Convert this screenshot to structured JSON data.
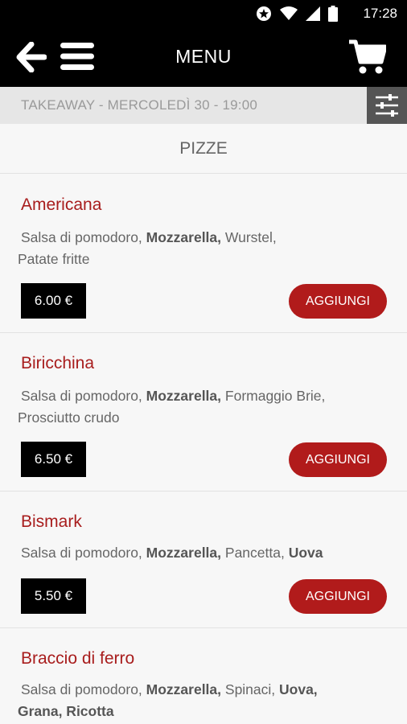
{
  "status_bar": {
    "time": "17:28",
    "icons": [
      "notification-star-icon",
      "wifi-icon",
      "cell-signal-icon",
      "battery-icon"
    ]
  },
  "app_bar": {
    "title": "MENU",
    "back_icon": "back-arrow-icon",
    "menu_icon": "hamburger-menu-icon",
    "cart_icon": "cart-icon"
  },
  "info_bar": {
    "text": "TAKEAWAY - MERCOLEDÌ 30 - 19:00",
    "filter_icon": "filter-sliders-icon"
  },
  "section": {
    "title": "PIZZE"
  },
  "items": [
    {
      "name": "Americana",
      "desc_parts": [
        {
          "text": "Salsa di pomodoro, ",
          "bold": false
        },
        {
          "text": "Mozzarella,",
          "bold": true
        },
        {
          "text": " Wurstel,",
          "bold": false
        },
        {
          "text": " Patate fritte",
          "bold": false
        }
      ],
      "price": "6.00 €",
      "add_label": "AGGIUNGI"
    },
    {
      "name": "Biricchina",
      "desc_parts": [
        {
          "text": "Salsa di pomodoro, ",
          "bold": false
        },
        {
          "text": "Mozzarella,",
          "bold": true
        },
        {
          "text": " Formaggio Brie,",
          "bold": false
        },
        {
          "text": " Prosciutto crudo",
          "bold": false
        }
      ],
      "price": "6.50 €",
      "add_label": "AGGIUNGI"
    },
    {
      "name": "Bismark",
      "desc_parts": [
        {
          "text": "Salsa di pomodoro, ",
          "bold": false
        },
        {
          "text": "Mozzarella,",
          "bold": true
        },
        {
          "text": " Pancetta, ",
          "bold": false
        },
        {
          "text": "Uova",
          "bold": true
        }
      ],
      "price": "5.50 €",
      "add_label": "AGGIUNGI"
    },
    {
      "name": "Braccio di ferro",
      "desc_parts": [
        {
          "text": "Salsa di pomodoro, ",
          "bold": false
        },
        {
          "text": "Mozzarella,",
          "bold": true
        },
        {
          "text": " Spinaci, ",
          "bold": false
        },
        {
          "text": "Uova,",
          "bold": true
        },
        {
          "text": " Grana, Ricotta",
          "bold": true
        }
      ],
      "price": "",
      "add_label": ""
    }
  ],
  "colors": {
    "accent_red": "#b11b1b",
    "name_red": "#a81d1d",
    "bar_black": "#000000",
    "info_bg": "#e6e6e6",
    "filter_bg": "#555555"
  }
}
